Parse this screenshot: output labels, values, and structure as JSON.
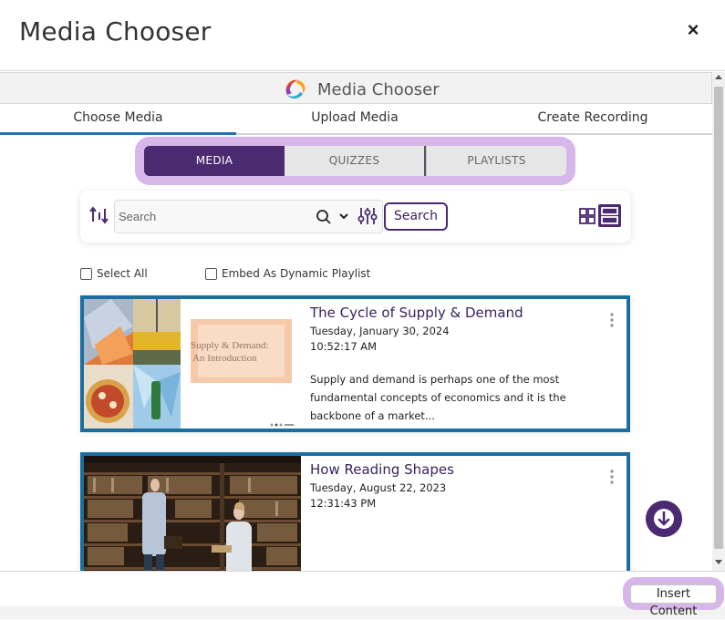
{
  "dialog": {
    "title": "Media Chooser",
    "close_label": "×"
  },
  "app": {
    "name": "Media Chooser"
  },
  "tabs": [
    {
      "label": "Choose Media",
      "active": true
    },
    {
      "label": "Upload Media",
      "active": false
    },
    {
      "label": "Create Recording",
      "active": false
    }
  ],
  "segments": [
    {
      "label": "MEDIA",
      "active": true
    },
    {
      "label": "QUIZZES",
      "active": false
    },
    {
      "label": "PLAYLISTS",
      "active": false
    }
  ],
  "search": {
    "placeholder": "Search",
    "button_label": "Search"
  },
  "options": {
    "select_all": "Select All",
    "embed_playlist": "Embed As Dynamic Playlist"
  },
  "media": [
    {
      "title": "The Cycle of Supply & Demand",
      "date": "Tuesday, January 30, 2024",
      "time": "10:52:17 AM",
      "description": "Supply and demand is perhaps one of the most fundamental concepts of economics and it is the backbone of a market...",
      "thumb_text": "Supply & Demand: An Introduction"
    },
    {
      "title": "How Reading Shapes",
      "date": "Tuesday, August 22, 2023",
      "time": "12:31:43 PM",
      "description": ""
    }
  ],
  "footer": {
    "insert_label": "Insert Content"
  },
  "colors": {
    "accent": "#4b2a72",
    "highlight": "#d7b7ea",
    "card_border": "#1b6ea0",
    "tab_active": "#1f73b7"
  }
}
